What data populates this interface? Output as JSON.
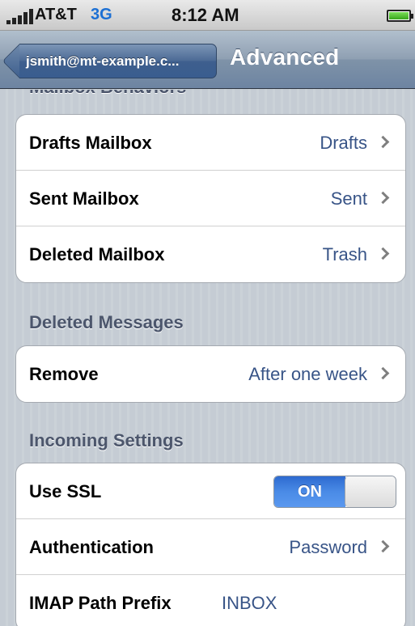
{
  "status_bar": {
    "carrier": "AT&T",
    "network": "3G",
    "time": "8:12 AM"
  },
  "nav": {
    "back_label": "jsmith@mt-example.c...",
    "title": "Advanced"
  },
  "sections": {
    "mailbox_behaviors": {
      "header": "Mailbox Behaviors",
      "rows": [
        {
          "label": "Drafts Mailbox",
          "value": "Drafts"
        },
        {
          "label": "Sent Mailbox",
          "value": "Sent"
        },
        {
          "label": "Deleted Mailbox",
          "value": "Trash"
        }
      ]
    },
    "deleted_messages": {
      "header": "Deleted Messages",
      "rows": [
        {
          "label": "Remove",
          "value": "After one week"
        }
      ]
    },
    "incoming_settings": {
      "header": "Incoming Settings",
      "use_ssl": {
        "label": "Use SSL",
        "state": "ON"
      },
      "authentication": {
        "label": "Authentication",
        "value": "Password"
      },
      "imap_prefix": {
        "label": "IMAP Path Prefix",
        "value": "INBOX"
      }
    }
  },
  "colors": {
    "background": "#c5ccd4",
    "value_text": "#385487",
    "header_text": "#4c566c",
    "toggle_on": "#3a7ee0",
    "nav_bar": "#6d84a2"
  }
}
